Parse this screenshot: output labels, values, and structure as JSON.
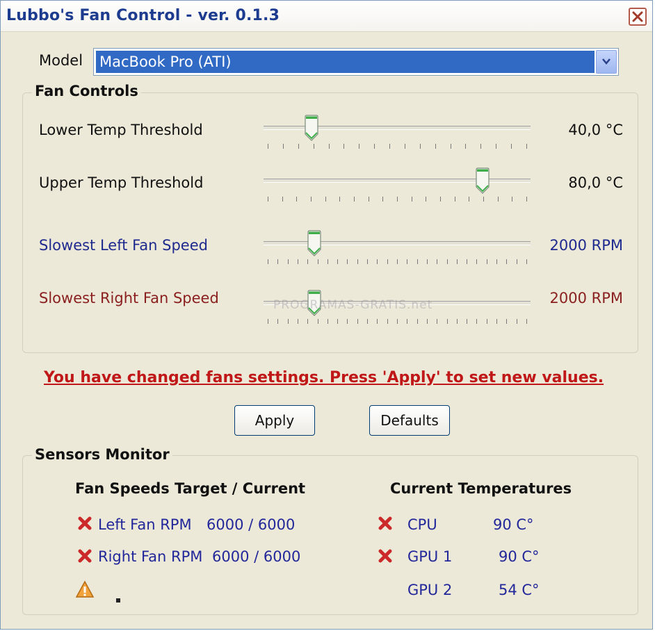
{
  "window": {
    "title": "Lubbo's Fan Control  -  ver. 0.1.3"
  },
  "model": {
    "label": "Model",
    "selected": "MacBook Pro (ATI)"
  },
  "fan_controls": {
    "title": "Fan Controls",
    "sliders": [
      {
        "label": "Lower Temp Threshold",
        "value_text": "40,0 °C",
        "position": 0.18,
        "label_color": "#111111",
        "value_color": "#111111",
        "tick_count": 18
      },
      {
        "label": "Upper Temp Threshold",
        "value_text": "80,0 °C",
        "position": 0.82,
        "label_color": "#111111",
        "value_color": "#111111",
        "tick_count": 19
      },
      {
        "label": "Slowest Left Fan Speed",
        "value_text": "2000 RPM",
        "position": 0.19,
        "label_color": "#1f2a8f",
        "value_color": "#1f2a8f",
        "tick_count": 27
      },
      {
        "label": "Slowest Right Fan Speed",
        "value_text": "2000 RPM",
        "position": 0.19,
        "label_color": "#8b2020",
        "value_color": "#8b2020",
        "tick_count": 27
      }
    ]
  },
  "warning": "You have changed fans settings. Press 'Apply' to set new values.",
  "buttons": {
    "apply": "Apply",
    "defaults": "Defaults"
  },
  "watermark": "PROGRAMAS-GRATIS.net",
  "sensors": {
    "title": "Sensors Monitor",
    "fan_header": "Fan Speeds Target / Current",
    "temp_header": "Current  Temperatures",
    "fans": [
      {
        "label": "Left  Fan RPM",
        "value": "6000 / 6000"
      },
      {
        "label": "Right Fan RPM",
        "value": "6000 / 6000"
      }
    ],
    "temps": [
      {
        "label": "CPU",
        "value": "90 C°"
      },
      {
        "label": "GPU 1",
        "value": "90 C°"
      },
      {
        "label": "GPU 2",
        "value": "54 C°"
      }
    ]
  },
  "icons": {
    "error": "red-x-icon",
    "warning": "warning-triangle-icon",
    "close": "close-icon",
    "dropdown": "chevron-down-icon"
  },
  "colors": {
    "title": "#1d3c8f",
    "selection": "#316ac5",
    "warning": "#c01818",
    "fan_text": "#22279a"
  }
}
